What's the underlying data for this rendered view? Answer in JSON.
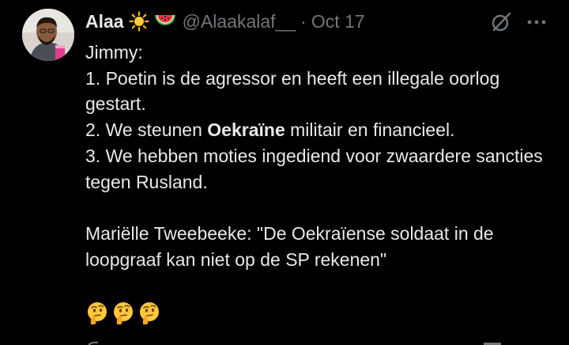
{
  "tweet": {
    "author_name": "Alaa",
    "author_emojis": [
      "sun-emoji",
      "watermelon-emoji"
    ],
    "handle": "@Alaakalaf__",
    "separator": "·",
    "date": "Oct 17",
    "lines": [
      "Jimmy:",
      "1. Poetin is de agressor en heeft een illegale oorlog gestart.",
      {
        "before": "2. We steunen ",
        "bold": "Oekraïne",
        "after": " militair en financieel."
      },
      "3. We hebben moties ingediend voor zwaardere sancties tegen Rusland.",
      "Mariëlle Tweebeeke: \"De Oekraïense soldaat in de loopgraaf kan niet op de SP rekenen\""
    ],
    "reaction_emojis": [
      "thinking-face-emoji",
      "thinking-face-emoji",
      "thinking-face-emoji"
    ]
  },
  "colors": {
    "background": "#000000",
    "text": "#e7e9ea",
    "muted": "#71767b"
  },
  "icons": {
    "grok": "grok-icon",
    "more": "more-icon"
  }
}
